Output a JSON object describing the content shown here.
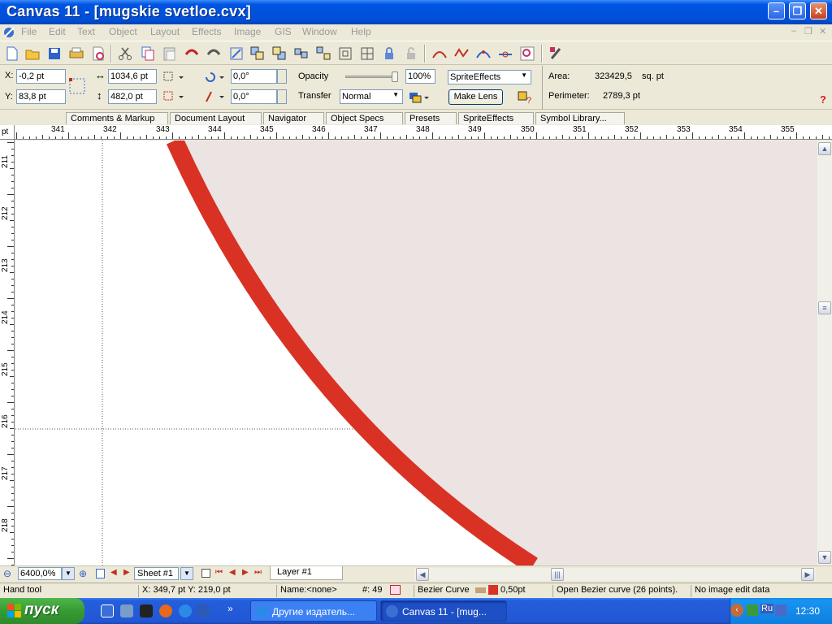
{
  "window": {
    "title": "Canvas 11 - [mugskie svetloe.cvx]"
  },
  "menu": [
    "File",
    "Edit",
    "Text",
    "Object",
    "Layout",
    "Effects",
    "Image",
    "GIS",
    "Window",
    "Help"
  ],
  "properties": {
    "x_label": "X:",
    "x_value": "-0,2 pt",
    "y_label": "Y:",
    "y_value": "83,8 pt",
    "width_value": "1034,6 pt",
    "height_value": "482,0 pt",
    "rotation_value": "0,0°",
    "skew_value": "0,0°",
    "opacity_label": "Opacity",
    "opacity_value": "100%",
    "opacity_level": 1.0,
    "transfer_label": "Transfer",
    "transfer_value": "Normal",
    "effects_select": "SpriteEffects",
    "make_lens_label": "Make Lens",
    "area_label": "Area:",
    "area_value": "323429,5",
    "area_unit": "sq. pt",
    "perimeter_label": "Perimeter:",
    "perimeter_value": "2789,3 pt",
    "help_glyph": "?"
  },
  "tabs": [
    "Comments & Markup",
    "Document Layout",
    "Navigator",
    "Object Specs",
    "Presets",
    "SpriteEffects",
    "Symbol Library..."
  ],
  "ruler": {
    "unit": "pt",
    "h_labels": [
      "341",
      "342",
      "343",
      "344",
      "345",
      "346",
      "347",
      "348",
      "349",
      "350",
      "351",
      "352",
      "353",
      "354",
      "355"
    ],
    "v_labels": [
      "211",
      "212",
      "213",
      "214",
      "215",
      "216",
      "217",
      "218"
    ]
  },
  "bottom": {
    "zoom": "6400,0%",
    "sheet": "Sheet #1",
    "layer": "Layer #1"
  },
  "status": {
    "tool": "Hand tool",
    "coords": "X: 349,7 pt Y: 219,0 pt",
    "name": "Name:<none>",
    "count": "#: 49",
    "object_type": "Bezier Curve",
    "stroke_width": "0,50pt",
    "stroke_color": "#d93224",
    "description": "Open Bezier curve (26 points).",
    "image_edit": "No image edit data"
  },
  "taskbar": {
    "start_label": "пуск",
    "tasks": [
      "Другие издатель...",
      "Canvas 11 - [mug..."
    ],
    "lang": "Ru",
    "clock": "12:30"
  },
  "colors": {
    "accent_red": "#d93224",
    "fill_gray": "#ebe4e2",
    "title_blue": "#0054e3"
  }
}
